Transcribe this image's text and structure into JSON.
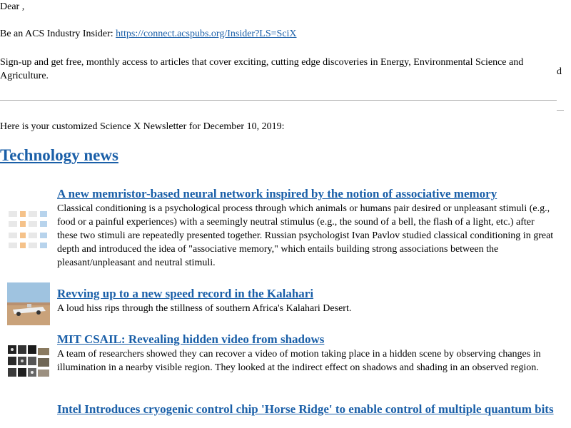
{
  "greeting": "Dear ,",
  "ad": {
    "lead": "Be an ACS Industry Insider: ",
    "link_text": "https://connect.acspubs.org/Insider?LS=SciX",
    "body": "Sign-up and get free, monthly access to articles that cover exciting, cutting edge discoveries in Energy, Environmental Science and Agriculture.",
    "stray_char": "d"
  },
  "intro": "Here is your customized Science X Newsletter for December 10, 2019:",
  "section_title": "Technology news",
  "articles": [
    {
      "title": "A new memristor-based neural network inspired by the notion of associative memory",
      "body": "Classical conditioning is a psychological process through which animals or humans pair desired or unpleasant stimuli (e.g., food or a painful experiences) with a seemingly neutral stimulus (e.g., the sound of a bell, the flash of a light, etc.) after these two stimuli are repeatedly presented together. Russian psychologist Ivan Pavlov studied classical conditioning in great depth and introduced the idea of \"associative memory,\" which entails building strong associations between the pleasant/unpleasant and neutral stimuli.",
      "thumb": "memristor-figure-thumbnail"
    },
    {
      "title": "Revving up to a new speed record in the Kalahari",
      "body": "A loud hiss rips through the stillness of southern Africa's Kalahari Desert.",
      "thumb": "speed-car-thumbnail"
    },
    {
      "title": "MIT CSAIL: Revealing hidden video from shadows",
      "body": "A team of researchers showed they can recover a video of motion taking place in a hidden scene by observing changes in illumination in a nearby visible region. They looked at the indirect effect on shadows and shading in an observed region.",
      "thumb": "shadow-video-grid-thumbnail"
    },
    {
      "title": "Intel Introduces cryogenic control chip 'Horse Ridge' to enable control of multiple quantum bits",
      "body": "",
      "thumb": ""
    }
  ],
  "colors": {
    "link": "#1a5fa8",
    "text": "#000000",
    "rule": "#a8a8a8"
  }
}
